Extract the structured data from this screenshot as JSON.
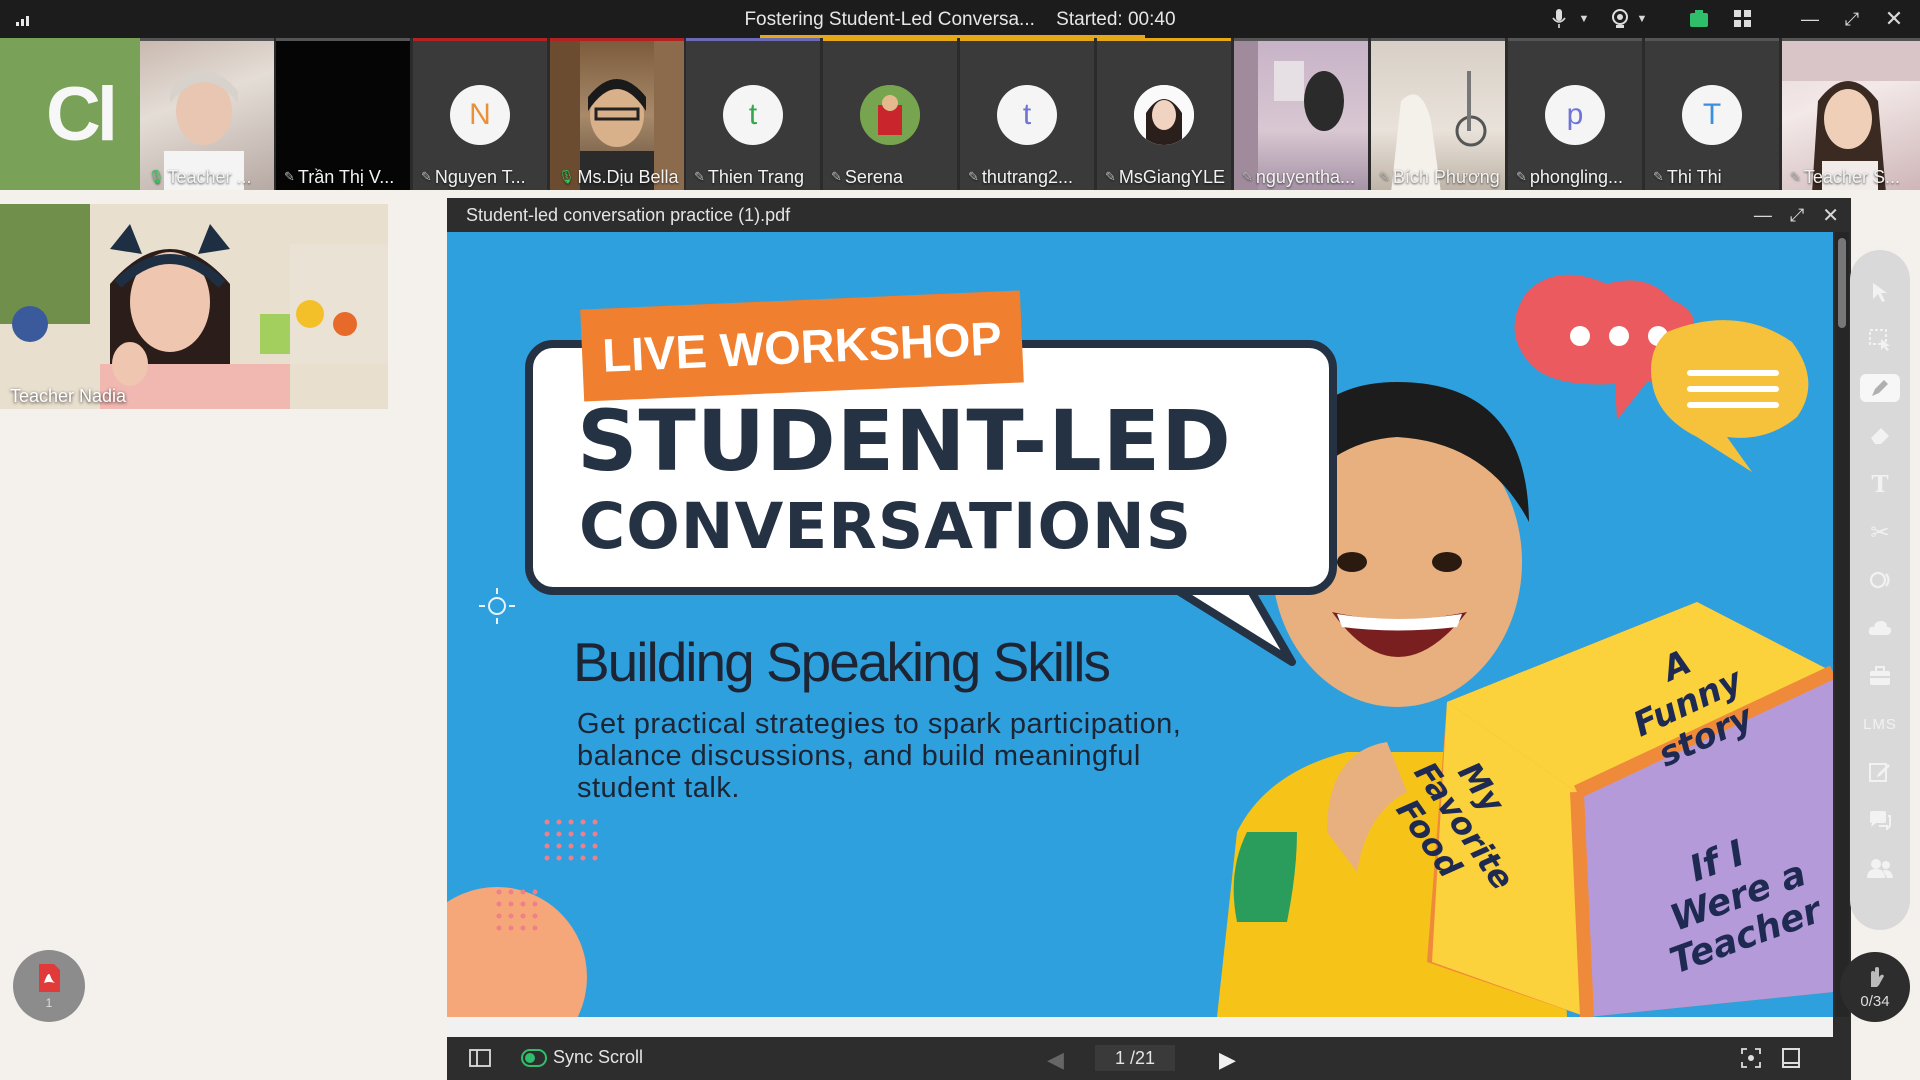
{
  "topbar": {
    "title": "Fostering Student-Led Conversa...",
    "started": "Started: 00:40",
    "icons": [
      "signal-icon",
      "microphone-icon",
      "camera-icon",
      "record-icon",
      "grid-layout-icon",
      "minimize-icon",
      "fullscreen-icon",
      "close-icon"
    ]
  },
  "participants": [
    {
      "name": "Teacher ...",
      "mic": "on",
      "type": "video"
    },
    {
      "name": "Trần Thị V...",
      "mic": "muted",
      "type": "dark"
    },
    {
      "name": "Nguyen T...",
      "mic": "muted",
      "type": "avatar",
      "initial": "N",
      "color": "#e8903a"
    },
    {
      "name": "Ms.Dịu Bella",
      "mic": "on",
      "type": "video"
    },
    {
      "name": "Thien Trang",
      "mic": "muted",
      "type": "avatar",
      "initial": "t",
      "color": "#35a84f"
    },
    {
      "name": "Serena",
      "mic": "muted",
      "type": "photo"
    },
    {
      "name": "thutrang2...",
      "mic": "muted",
      "type": "avatar",
      "initial": "t",
      "color": "#6f74d6"
    },
    {
      "name": "MsGiangYLE",
      "mic": "muted",
      "type": "photo"
    },
    {
      "name": "nguyentha...",
      "mic": "muted",
      "type": "video"
    },
    {
      "name": "Bích Phương",
      "mic": "muted",
      "type": "video"
    },
    {
      "name": "phongling...",
      "mic": "muted",
      "type": "avatar",
      "initial": "p",
      "color": "#6f74d6"
    },
    {
      "name": "Thi Thi",
      "mic": "muted",
      "type": "avatar",
      "initial": "T",
      "color": "#3c8fe0"
    },
    {
      "name": "Teacher S...",
      "mic": "muted",
      "type": "video"
    }
  ],
  "brand": {
    "text": "Cl"
  },
  "main_video": {
    "name": "Teacher Nadia"
  },
  "pdf": {
    "filename": "Student-led conversation practice (1).pdf",
    "slide": {
      "tag": "LIVE WORKSHOP",
      "headline1": "STUDENT-LED",
      "headline2": "CONVERSATIONS",
      "subtitle": "Building Speaking Skills",
      "description": "Get practical strategies to spark participation, balance discussions, and build meaningful student talk.",
      "dice_face1": "A Funny story",
      "dice_face2": "My Favorite Food",
      "dice_face3": "If I Were a Teacher"
    },
    "footer": {
      "sync_scroll": "Sync Scroll",
      "page": "1 /21"
    }
  },
  "toolbar": {
    "tools": [
      "cursor-icon",
      "select-area-icon",
      "pen-icon",
      "eraser-icon",
      "text-icon",
      "scissors-icon",
      "shape-icon",
      "cloud-icon",
      "toolbox-icon",
      "lms-label",
      "edit-icon",
      "chat-icon",
      "users-icon"
    ],
    "lms_label": "LMS"
  },
  "user_counter": {
    "value": "0/34"
  },
  "pdf_fab": {
    "count": "1"
  }
}
